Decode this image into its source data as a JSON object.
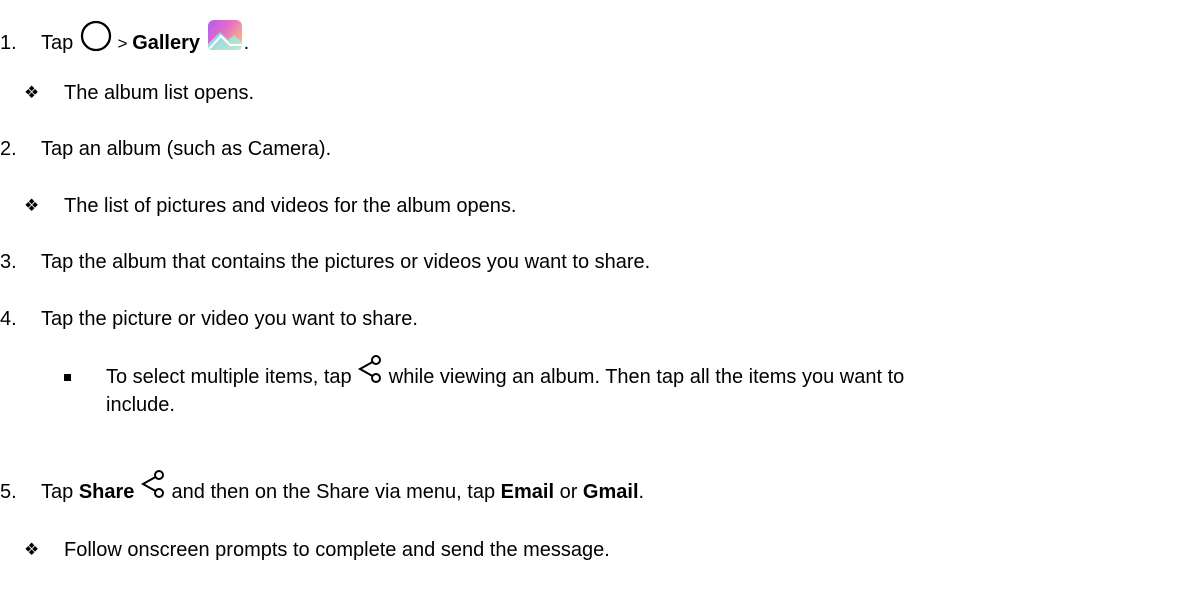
{
  "steps": [
    {
      "num": "1.",
      "pre": "Tap ",
      "sep": " > ",
      "bold": "Gallery",
      "post": ".",
      "icons": [
        "home-circle-icon",
        "gallery-app-icon"
      ]
    },
    {
      "bullet": "❖",
      "text": "The album list opens."
    },
    {
      "num": "2.",
      "text": "Tap an album (such as Camera)."
    },
    {
      "bullet": "❖",
      "text": "The list of pictures and videos for the album opens."
    },
    {
      "num": "3.",
      "text": "Tap the album that contains the pictures or videos you want to share."
    },
    {
      "num": "4.",
      "text": "Tap the picture or video you want to share."
    },
    {
      "sub_pre": "To select multiple items, tap ",
      "sub_post": " while viewing an album. Then tap all the items you want to",
      "sub_cont": "include.",
      "icon": "share-icon"
    },
    {
      "num": "5.",
      "pre": "Tap ",
      "bold1": "Share",
      "mid": " and then on the Share via menu, tap ",
      "bold2": "Email",
      "or": " or ",
      "bold3": "Gmail",
      "post": ".",
      "icon": "share-icon"
    },
    {
      "bullet": "❖",
      "text": "Follow onscreen prompts to complete and send the message."
    }
  ]
}
